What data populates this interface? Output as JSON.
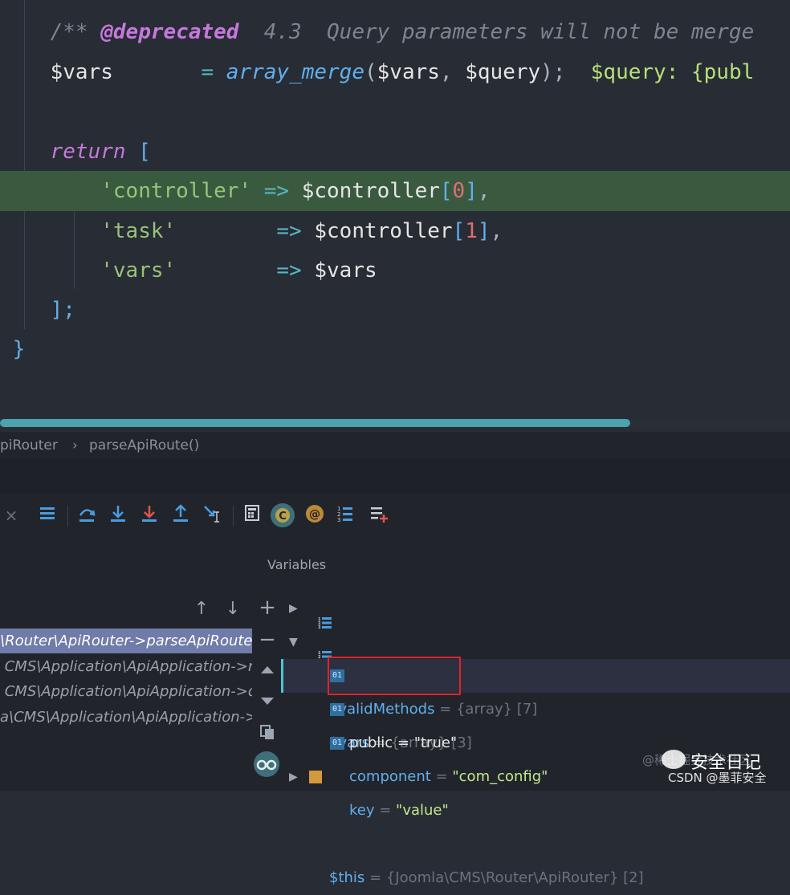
{
  "editor": {
    "line1": {
      "comment_start": "/** ",
      "tag": "@deprecated",
      "comment_rest": "  4.3  Query parameters will not be merge"
    },
    "line2": {
      "var": "$vars",
      "eq": "       = ",
      "fn": "array_merge",
      "paren_open": "(",
      "arg1": "$vars",
      "comma": ", ",
      "arg2": "$query",
      "paren_close": ");",
      "hint": "  $query: {publ"
    },
    "line4": {
      "kw": "return",
      "bracket": " ["
    },
    "line5": {
      "key": "'controller'",
      "arrow": " => ",
      "var": "$controller",
      "bopen": "[",
      "idx": "0",
      "bclose": "]",
      "comma": ","
    },
    "line6": {
      "key": "'task'",
      "pad": "       ",
      "arrow": " => ",
      "var": "$controller",
      "bopen": "[",
      "idx": "1",
      "bclose": "]",
      "comma": ","
    },
    "line7": {
      "key": "'vars'",
      "pad": "       ",
      "arrow": " => ",
      "var": "$vars"
    },
    "line8": {
      "close": "];"
    },
    "line9": {
      "close": "}"
    }
  },
  "breadcrumb": {
    "class": "piRouter",
    "sep": "›",
    "method": "parseApiRoute()"
  },
  "debug": {
    "variables_title": "Variables",
    "frames": [
      "\\Router\\ApiRouter->parseApiRoute(",
      " CMS\\Application\\ApiApplication->r",
      " CMS\\Application\\ApiApplication->d",
      "a\\CMS\\Application\\ApiApplication->"
    ],
    "vars": {
      "validMethods": {
        "name": "$validMethods",
        "eq": " = ",
        "meta": "{array} [7]"
      },
      "vars": {
        "name": "$vars",
        "eq": " = ",
        "meta": "{array} [3]"
      },
      "public": {
        "name": "public",
        "eq": " = ",
        "value": "\"true\""
      },
      "component": {
        "name": "component",
        "eq": " = ",
        "value": "\"com_config\""
      },
      "key": {
        "name": "key",
        "eq": " = ",
        "value": "\"value\""
      },
      "this": {
        "name": "$this",
        "eq": " = ",
        "meta": "{Joomla\\CMS\\Router\\ApiRouter} [2]"
      }
    },
    "icons": {
      "close": "×",
      "plus": "+",
      "minus": "−",
      "up": "↑",
      "down": "↓"
    }
  },
  "watermark": {
    "title": "安全日记",
    "sub": "CSDN @墨菲安全",
    "faint": "@稀土掘金技术社区"
  },
  "colors": {
    "accent": "#4aa3ad",
    "highlight_line": "#3a5a40",
    "red_box": "#e0242b"
  }
}
